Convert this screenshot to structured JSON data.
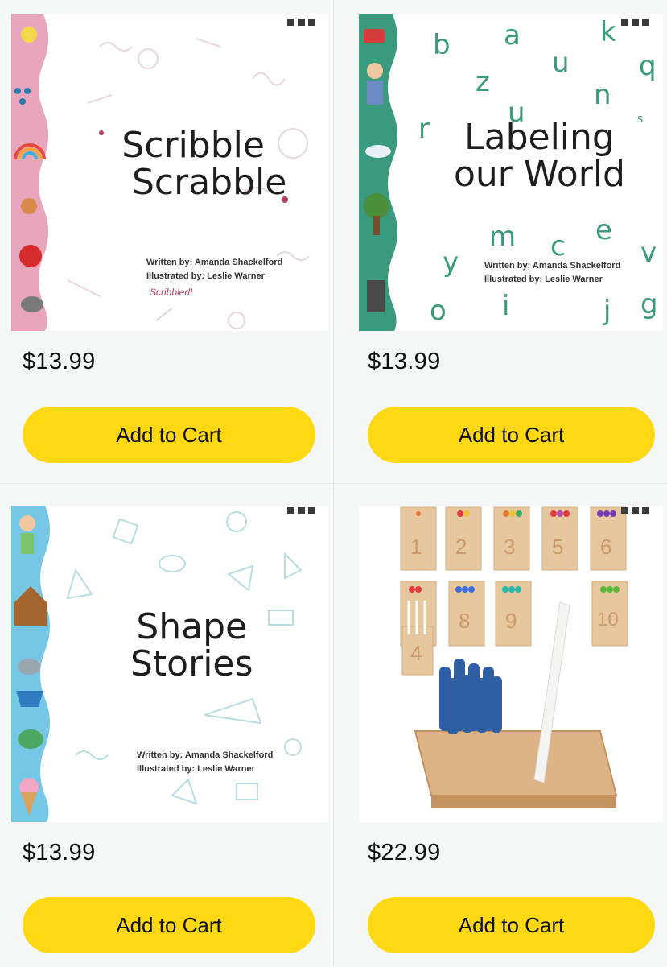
{
  "products": [
    {
      "title_line1": "Scribble",
      "title_line2": "Scrabble",
      "written_by": "Written by: Amanda Shackelford",
      "illustrated_by": "Illustrated by: Leslie Warner",
      "scribbled_note": "Scribbled!",
      "price": "$13.99",
      "cart_label": "Add to Cart"
    },
    {
      "title_line1": "Labeling",
      "title_line2": "our World",
      "written_by": "Written by: Amanda Shackelford",
      "illustrated_by": "Illustrated by: Leslie Warner",
      "letters": [
        "b",
        "a",
        "u",
        "k",
        "z",
        "u",
        "n",
        "q",
        "r",
        "s",
        "m",
        "c",
        "e",
        "y",
        "o",
        "v",
        "i",
        "j",
        "g"
      ],
      "price": "$13.99",
      "cart_label": "Add to Cart"
    },
    {
      "title_line1": "Shape",
      "title_line2": "Stories",
      "written_by": "Written by: Amanda Shackelford",
      "illustrated_by": "Illustrated by: Leslie Warner",
      "price": "$13.99",
      "cart_label": "Add to Cart"
    },
    {
      "card_numbers": [
        "1",
        "2",
        "3",
        "5",
        "6",
        "8",
        "9",
        "10",
        "4"
      ],
      "price": "$22.99",
      "cart_label": "Add to Cart"
    }
  ],
  "colors": {
    "button": "#ffd814",
    "card_bg": "#f5f6f6",
    "border_pink": "#e8a6bd",
    "border_green": "#3a9a7d",
    "border_blue": "#76c7e6"
  }
}
